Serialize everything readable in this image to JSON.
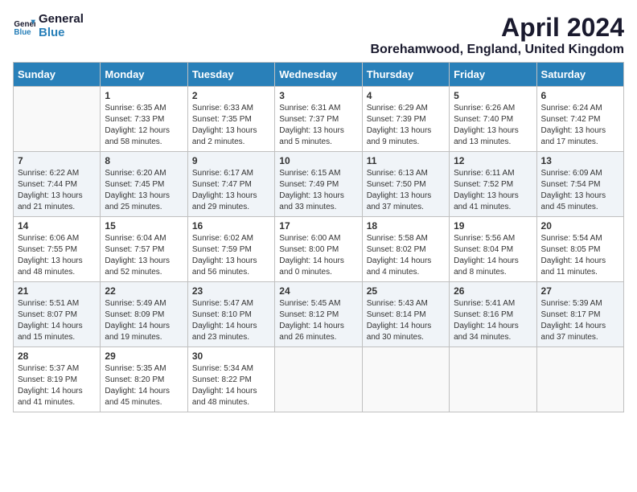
{
  "logo": {
    "line1": "General",
    "line2": "Blue"
  },
  "title": "April 2024",
  "location": "Borehamwood, England, United Kingdom",
  "weekdays": [
    "Sunday",
    "Monday",
    "Tuesday",
    "Wednesday",
    "Thursday",
    "Friday",
    "Saturday"
  ],
  "weeks": [
    [
      {
        "day": "",
        "content": ""
      },
      {
        "day": "1",
        "content": "Sunrise: 6:35 AM\nSunset: 7:33 PM\nDaylight: 12 hours\nand 58 minutes."
      },
      {
        "day": "2",
        "content": "Sunrise: 6:33 AM\nSunset: 7:35 PM\nDaylight: 13 hours\nand 2 minutes."
      },
      {
        "day": "3",
        "content": "Sunrise: 6:31 AM\nSunset: 7:37 PM\nDaylight: 13 hours\nand 5 minutes."
      },
      {
        "day": "4",
        "content": "Sunrise: 6:29 AM\nSunset: 7:39 PM\nDaylight: 13 hours\nand 9 minutes."
      },
      {
        "day": "5",
        "content": "Sunrise: 6:26 AM\nSunset: 7:40 PM\nDaylight: 13 hours\nand 13 minutes."
      },
      {
        "day": "6",
        "content": "Sunrise: 6:24 AM\nSunset: 7:42 PM\nDaylight: 13 hours\nand 17 minutes."
      }
    ],
    [
      {
        "day": "7",
        "content": "Sunrise: 6:22 AM\nSunset: 7:44 PM\nDaylight: 13 hours\nand 21 minutes."
      },
      {
        "day": "8",
        "content": "Sunrise: 6:20 AM\nSunset: 7:45 PM\nDaylight: 13 hours\nand 25 minutes."
      },
      {
        "day": "9",
        "content": "Sunrise: 6:17 AM\nSunset: 7:47 PM\nDaylight: 13 hours\nand 29 minutes."
      },
      {
        "day": "10",
        "content": "Sunrise: 6:15 AM\nSunset: 7:49 PM\nDaylight: 13 hours\nand 33 minutes."
      },
      {
        "day": "11",
        "content": "Sunrise: 6:13 AM\nSunset: 7:50 PM\nDaylight: 13 hours\nand 37 minutes."
      },
      {
        "day": "12",
        "content": "Sunrise: 6:11 AM\nSunset: 7:52 PM\nDaylight: 13 hours\nand 41 minutes."
      },
      {
        "day": "13",
        "content": "Sunrise: 6:09 AM\nSunset: 7:54 PM\nDaylight: 13 hours\nand 45 minutes."
      }
    ],
    [
      {
        "day": "14",
        "content": "Sunrise: 6:06 AM\nSunset: 7:55 PM\nDaylight: 13 hours\nand 48 minutes."
      },
      {
        "day": "15",
        "content": "Sunrise: 6:04 AM\nSunset: 7:57 PM\nDaylight: 13 hours\nand 52 minutes."
      },
      {
        "day": "16",
        "content": "Sunrise: 6:02 AM\nSunset: 7:59 PM\nDaylight: 13 hours\nand 56 minutes."
      },
      {
        "day": "17",
        "content": "Sunrise: 6:00 AM\nSunset: 8:00 PM\nDaylight: 14 hours\nand 0 minutes."
      },
      {
        "day": "18",
        "content": "Sunrise: 5:58 AM\nSunset: 8:02 PM\nDaylight: 14 hours\nand 4 minutes."
      },
      {
        "day": "19",
        "content": "Sunrise: 5:56 AM\nSunset: 8:04 PM\nDaylight: 14 hours\nand 8 minutes."
      },
      {
        "day": "20",
        "content": "Sunrise: 5:54 AM\nSunset: 8:05 PM\nDaylight: 14 hours\nand 11 minutes."
      }
    ],
    [
      {
        "day": "21",
        "content": "Sunrise: 5:51 AM\nSunset: 8:07 PM\nDaylight: 14 hours\nand 15 minutes."
      },
      {
        "day": "22",
        "content": "Sunrise: 5:49 AM\nSunset: 8:09 PM\nDaylight: 14 hours\nand 19 minutes."
      },
      {
        "day": "23",
        "content": "Sunrise: 5:47 AM\nSunset: 8:10 PM\nDaylight: 14 hours\nand 23 minutes."
      },
      {
        "day": "24",
        "content": "Sunrise: 5:45 AM\nSunset: 8:12 PM\nDaylight: 14 hours\nand 26 minutes."
      },
      {
        "day": "25",
        "content": "Sunrise: 5:43 AM\nSunset: 8:14 PM\nDaylight: 14 hours\nand 30 minutes."
      },
      {
        "day": "26",
        "content": "Sunrise: 5:41 AM\nSunset: 8:16 PM\nDaylight: 14 hours\nand 34 minutes."
      },
      {
        "day": "27",
        "content": "Sunrise: 5:39 AM\nSunset: 8:17 PM\nDaylight: 14 hours\nand 37 minutes."
      }
    ],
    [
      {
        "day": "28",
        "content": "Sunrise: 5:37 AM\nSunset: 8:19 PM\nDaylight: 14 hours\nand 41 minutes."
      },
      {
        "day": "29",
        "content": "Sunrise: 5:35 AM\nSunset: 8:20 PM\nDaylight: 14 hours\nand 45 minutes."
      },
      {
        "day": "30",
        "content": "Sunrise: 5:34 AM\nSunset: 8:22 PM\nDaylight: 14 hours\nand 48 minutes."
      },
      {
        "day": "",
        "content": ""
      },
      {
        "day": "",
        "content": ""
      },
      {
        "day": "",
        "content": ""
      },
      {
        "day": "",
        "content": ""
      }
    ]
  ]
}
